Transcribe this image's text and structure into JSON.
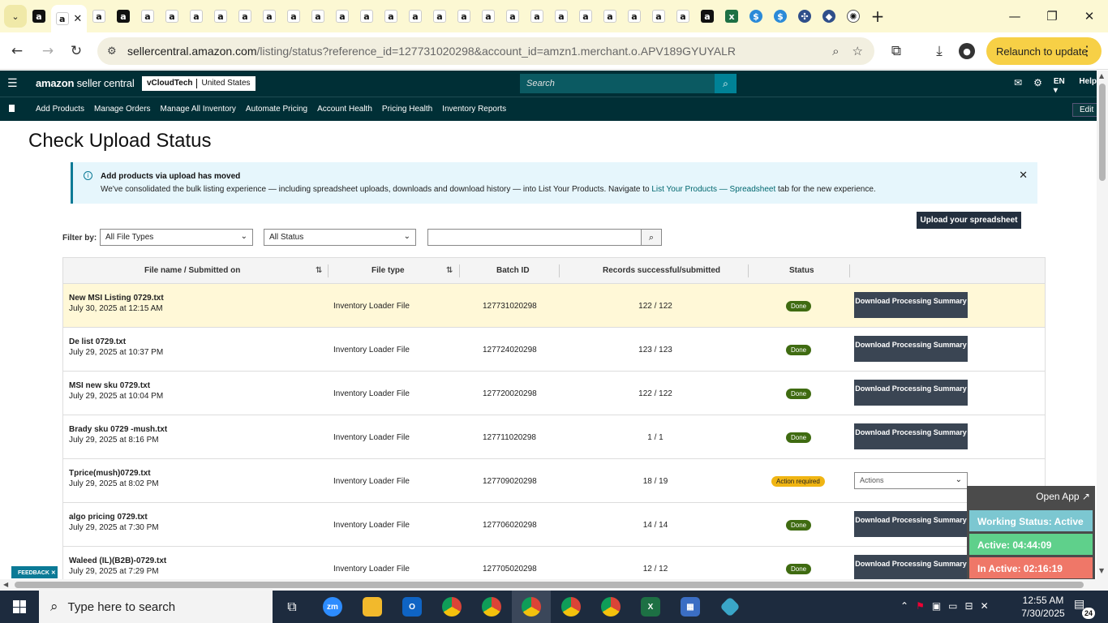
{
  "browser": {
    "url_host": "sellercentral.amazon.com",
    "url_path": "/listing/status?reference_id=127731020298&account_id=amzn1.merchant.o.APV189GYUYALR",
    "relaunch_label": "Relaunch to update",
    "tab_menu_glyph": "⌄",
    "tab_close_glyph": "✕",
    "new_tab_glyph": "+",
    "back_glyph": "←",
    "forward_glyph": "→",
    "reload_glyph": "↻",
    "window": {
      "minimize": "—",
      "restore": "❐",
      "close": "✕"
    }
  },
  "header": {
    "logo_bold": "amazon",
    "logo_rest": " seller central",
    "account_name": "vCloudTech",
    "account_region": "United States",
    "search_placeholder": "Search",
    "language": "EN ▾",
    "help": "Help"
  },
  "nav": {
    "links": [
      "Add Products",
      "Manage Orders",
      "Manage All Inventory",
      "Automate Pricing",
      "Account Health",
      "Pricing Health",
      "Inventory Reports"
    ],
    "edit_label": "Edit"
  },
  "page": {
    "title": "Check Upload Status",
    "notice": {
      "title": "Add products via upload has moved",
      "text_before": "We've consolidated the bulk listing experience — including spreadsheet uploads, downloads and download history — into List Your Products. Navigate to ",
      "link": "List Your Products — Spreadsheet",
      "text_after": " tab for the new experience."
    },
    "upload_button": "Upload your spreadsheet",
    "filter_label": "Filter by:",
    "file_type_select": "All File Types",
    "status_select": "All Status"
  },
  "table": {
    "headers": {
      "file": "File name / Submitted on",
      "type": "File type",
      "batch": "Batch ID",
      "records": "Records successful/submitted",
      "status": "Status"
    },
    "download_label": "Download Processing Summary",
    "actions_label": "Actions",
    "rows": [
      {
        "name": "New MSI Listing 0729.txt",
        "date": "July 30, 2025 at 12:15 AM",
        "type": "Inventory Loader File",
        "batch": "127731020298",
        "records": "122 / 122",
        "status": "Done"
      },
      {
        "name": "De list 0729.txt",
        "date": "July 29, 2025 at 10:37 PM",
        "type": "Inventory Loader File",
        "batch": "127724020298",
        "records": "123 / 123",
        "status": "Done"
      },
      {
        "name": "MSI new sku 0729.txt",
        "date": "July 29, 2025 at 10:04 PM",
        "type": "Inventory Loader File",
        "batch": "127720020298",
        "records": "122 / 122",
        "status": "Done"
      },
      {
        "name": "Brady sku 0729 -mush.txt",
        "date": "July 29, 2025 at 8:16 PM",
        "type": "Inventory Loader File",
        "batch": "127711020298",
        "records": "1 / 1",
        "status": "Done"
      },
      {
        "name": "Tprice(mush)0729.txt",
        "date": "July 29, 2025 at 8:02 PM",
        "type": "Inventory Loader File",
        "batch": "127709020298",
        "records": "18 / 19",
        "status": "Action required"
      },
      {
        "name": "algo pricing 0729.txt",
        "date": "July 29, 2025 at 7:30 PM",
        "type": "Inventory Loader File",
        "batch": "127706020298",
        "records": "14 / 14",
        "status": "Done"
      },
      {
        "name": "Waleed (IL)(B2B)-0729.txt",
        "date": "July 29, 2025 at 7:29 PM",
        "type": "Inventory Loader File",
        "batch": "127705020298",
        "records": "12 / 12",
        "status": "Done"
      }
    ]
  },
  "widget": {
    "open_app": "Open App ↗",
    "working_status": "Working Status: Active",
    "active": "Active: 04:44:09",
    "inactive": "In Active: 02:16:19"
  },
  "feedback": "FEEDBACK ✕",
  "taskbar": {
    "search_placeholder": "Type here to search",
    "time": "12:55 AM",
    "date": "7/30/2025",
    "notification_count": "24",
    "zoom_label": "zm"
  },
  "colors": {
    "header_bg": "#002f36",
    "done_badge": "#3f6b11",
    "action_badge": "#f0b513",
    "highlight_row": "#fff8d7",
    "relaunch": "#f7d046"
  }
}
